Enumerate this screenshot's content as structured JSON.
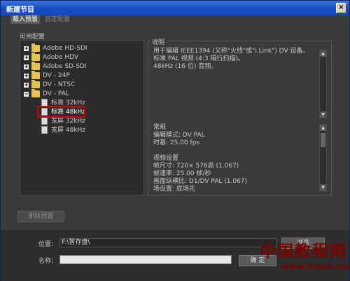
{
  "window": {
    "title": "新建节目",
    "close_glyph": "×"
  },
  "tabs": [
    {
      "label": "载入预置"
    },
    {
      "label": "自定配置"
    }
  ],
  "presets": {
    "label": "可用配置",
    "items": [
      {
        "label": "Adobe HD-SDI",
        "type": "folder",
        "state": "collapsed"
      },
      {
        "label": "Adobe HDV",
        "type": "folder",
        "state": "collapsed"
      },
      {
        "label": "Adobe SD-SDI",
        "type": "folder",
        "state": "collapsed"
      },
      {
        "label": "DV - 24P",
        "type": "folder",
        "state": "collapsed"
      },
      {
        "label": "DV - NTSC",
        "type": "folder",
        "state": "collapsed"
      },
      {
        "label": "DV - PAL",
        "type": "folder",
        "state": "expanded"
      },
      {
        "label": "标准 32kHz",
        "type": "preset"
      },
      {
        "label": "标准 48kHz",
        "type": "preset",
        "selected": true
      },
      {
        "label": "宽屏 32kHz",
        "type": "preset"
      },
      {
        "label": "宽屏 48kHz",
        "type": "preset"
      }
    ]
  },
  "description": {
    "legend": "说明",
    "lines": [
      "用于编辑 IEEE1394 (又称\"火线\"或\"i.Link\") DV 设备。",
      "标准 PAL 视频 (4:3 隔行扫描)。",
      "48kHz (16 位) 音频。"
    ]
  },
  "info": {
    "lines": [
      "常规",
      "编辑模式: DV PAL",
      "时基: 25.00 fps",
      "",
      "视频设置",
      "帧尺寸: 720× 576高 (1.067)",
      "帧速率: 25.00 帧/秒",
      "画面纵横比: D1/DV PAL (1.067)",
      "场设置: 底场先"
    ]
  },
  "buttons": {
    "delete_preset": "删除预置",
    "browse": "浏览",
    "ok": "确 定"
  },
  "location": {
    "label": "位置：",
    "value": "F:\\暂存盘\\"
  },
  "name": {
    "label": "名称：",
    "value": ""
  },
  "watermark": {
    "text": "中国教程网",
    "url": "www.jcwcn.com"
  }
}
